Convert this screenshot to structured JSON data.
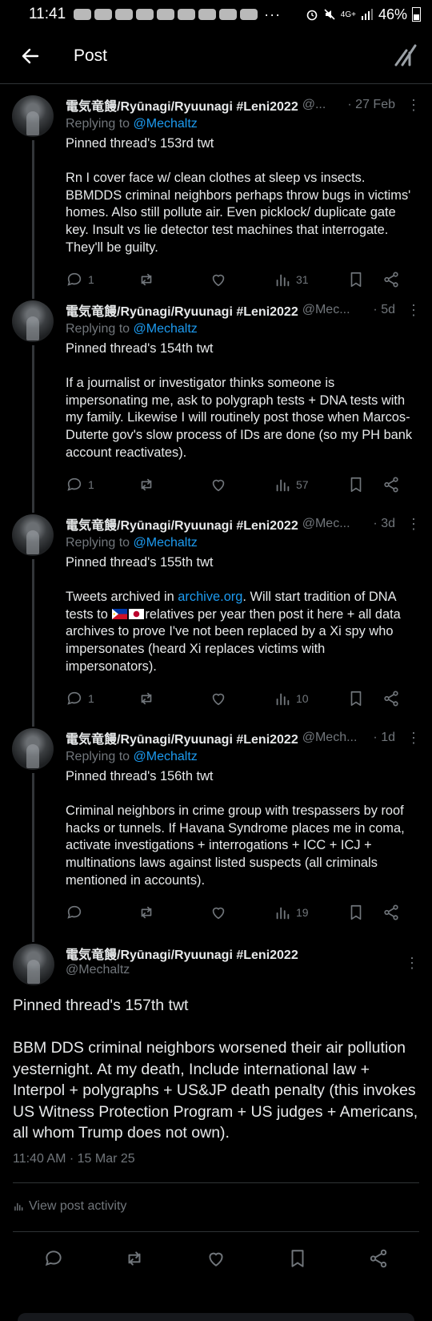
{
  "status_bar": {
    "time": "11:41",
    "more": "···",
    "network": "4G+",
    "battery": "46%"
  },
  "header": {
    "title": "Post"
  },
  "thread": [
    {
      "name": "電気竜饅/Ryūnagi/Ryuunagi #Leni2022",
      "handle": "@...",
      "date": "· 27 Feb",
      "replying_label": "Replying to",
      "replying_to": "@Mechaltz",
      "text": "Pinned thread's 153rd twt\n\nRn I cover face w/ clean clothes at sleep vs insects. BBMDDS criminal neighbors perhaps throw bugs in victims' homes. Also still pollute air. Even picklock/ duplicate gate key. Insult vs lie detector test machines that interrogate. They'll be guilty.",
      "replies": "1",
      "views": "31"
    },
    {
      "name": "電気竜饅/Ryūnagi/Ryuunagi #Leni2022",
      "handle": "@Mec...",
      "date": "· 5d",
      "replying_label": "Replying to",
      "replying_to": "@Mechaltz",
      "text": "Pinned thread's 154th twt\n\nIf a journalist or investigator thinks someone is impersonating me, ask to polygraph tests + DNA tests with my family. Likewise I will routinely post those when Marcos-Duterte gov's slow process of IDs are done (so my PH bank account reactivates).",
      "replies": "1",
      "views": "57"
    },
    {
      "name": "電気竜饅/Ryūnagi/Ryuunagi #Leni2022",
      "handle": "@Mec...",
      "date": "· 3d",
      "replying_label": "Replying to",
      "replying_to": "@Mechaltz",
      "text_1": "Pinned thread's 155th twt\n\nTweets archived in ",
      "link": "archive.org",
      "text_2": ". Will start tradition of DNA tests to ",
      "text_3": "relatives per year then post it here + all data archives to prove I've not been replaced by a Xi spy who impersonates (heard Xi replaces victims with impersonators).",
      "replies": "1",
      "views": "10"
    },
    {
      "name": "電気竜饅/Ryūnagi/Ryuunagi #Leni2022",
      "handle": "@Mech...",
      "date": "· 1d",
      "replying_label": "Replying to",
      "replying_to": "@Mechaltz",
      "text": "Pinned thread's 156th twt\n\nCriminal neighbors in crime group with trespassers by roof hacks or tunnels. If Havana Syndrome places me in coma, activate investigations + interrogations + ICC + ICJ + multinations laws against listed suspects (all criminals mentioned in accounts).",
      "replies": "",
      "views": "19"
    }
  ],
  "main": {
    "name": "電気竜饅/Ryūnagi/Ryuunagi #Leni2022",
    "handle": "@Mechaltz",
    "text": "Pinned thread's 157th twt\n\nBBM DDS criminal neighbors worsened their air pollution yesternight. At my death, Include international law + Interpol + polygraphs + US&JP death penalty (this invokes US Witness Protection Program + US judges + Americans, all whom Trump does not own).",
    "timestamp": "11:40 AM · 15 Mar 25",
    "activity_label": "View post activity"
  },
  "colors": {
    "background": "#000000",
    "text": "#e7e9ea",
    "muted": "#71767b",
    "link": "#1d9bf0",
    "divider": "#2f3336"
  }
}
